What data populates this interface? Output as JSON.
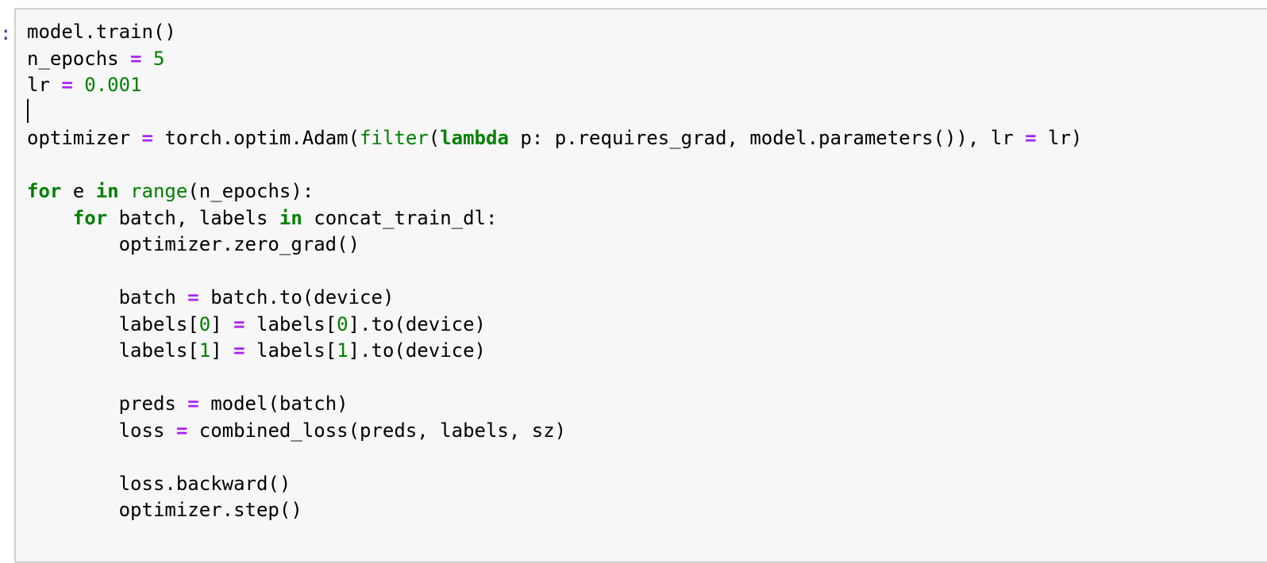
{
  "prompt": {
    "marker": ":"
  },
  "code_cell": {
    "lines": [
      [
        "model.train()"
      ],
      [
        "n_epochs ",
        "=",
        " ",
        "5"
      ],
      [
        "lr ",
        "=",
        " ",
        "0.001"
      ],
      [],
      [
        "optimizer ",
        "=",
        " torch.optim.Adam(",
        "filter",
        "(",
        "lambda",
        " p: p.requires_grad, model.parameters()), lr ",
        "=",
        " lr)"
      ],
      [],
      [
        "for",
        " e ",
        "in",
        " ",
        "range",
        "(n_epochs):"
      ],
      [
        "    ",
        "for",
        " batch, labels ",
        "in",
        " concat_train_dl:"
      ],
      [
        "        optimizer.zero_grad()"
      ],
      [],
      [
        "        batch ",
        "=",
        " batch.to(device)"
      ],
      [
        "        labels[",
        "0",
        "] ",
        "=",
        " labels[",
        "0",
        "].to(device)"
      ],
      [
        "        labels[",
        "1",
        "] ",
        "=",
        " labels[",
        "1",
        "].to(device)"
      ],
      [],
      [
        "        preds ",
        "=",
        " model(batch)"
      ],
      [
        "        loss ",
        "=",
        " combined_loss(preds, labels, sz)"
      ],
      [],
      [
        "        loss.backward()"
      ],
      [
        "        optimizer.step()"
      ]
    ]
  }
}
